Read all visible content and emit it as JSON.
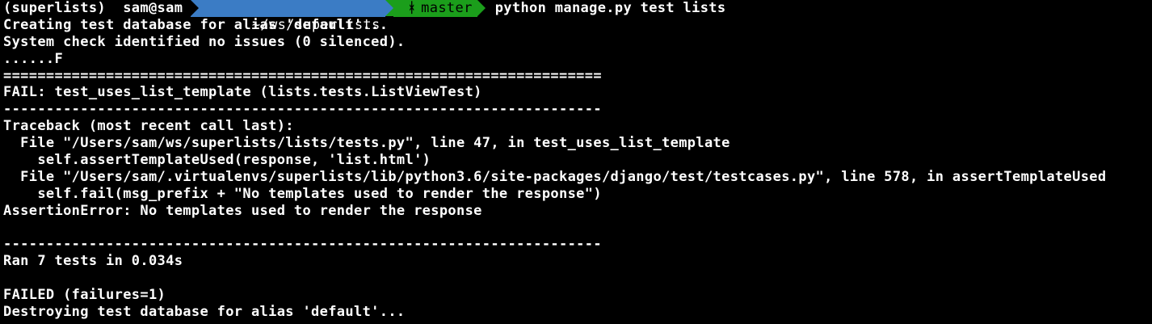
{
  "prompt": {
    "venv": "(superlists)",
    "user_host": "sam@sam",
    "path": "~/ws/superlists",
    "branch_icon": "ᚼ",
    "branch": "master",
    "command": "python manage.py test lists"
  },
  "output": [
    "Creating test database for alias 'default'...",
    "System check identified no issues (0 silenced).",
    "......F",
    "======================================================================",
    "FAIL: test_uses_list_template (lists.tests.ListViewTest)",
    "----------------------------------------------------------------------",
    "Traceback (most recent call last):",
    "  File \"/Users/sam/ws/superlists/lists/tests.py\", line 47, in test_uses_list_template",
    "    self.assertTemplateUsed(response, 'list.html')",
    "  File \"/Users/sam/.virtualenvs/superlists/lib/python3.6/site-packages/django/test/testcases.py\", line 578, in assertTemplateUsed",
    "    self.fail(msg_prefix + \"No templates used to render the response\")",
    "AssertionError: No templates used to render the response",
    "",
    "----------------------------------------------------------------------",
    "Ran 7 tests in 0.034s",
    "",
    "FAILED (failures=1)",
    "Destroying test database for alias 'default'..."
  ],
  "colors": {
    "background": "#000000",
    "text": "#ffffff",
    "path_segment": "#3b7cc5",
    "git_segment": "#1b9e1b"
  }
}
